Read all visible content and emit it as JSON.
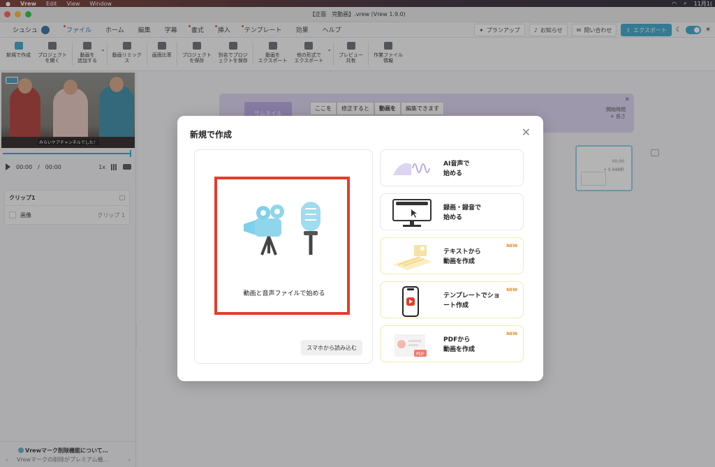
{
  "menubar": {
    "apple": "",
    "app": "Vrew",
    "edit": "Edit",
    "view": "View",
    "window": "Window",
    "time": "11月1("
  },
  "window": {
    "title": "【正面　完動画】.vrew (Vrew 1.9.0)"
  },
  "tabs": {
    "user": "シュシュ",
    "items": [
      {
        "label": "ファイル",
        "dot": true
      },
      {
        "label": "ホーム",
        "dot": false
      },
      {
        "label": "編集",
        "dot": false
      },
      {
        "label": "字幕",
        "dot": false
      },
      {
        "label": "書式",
        "dot": true
      },
      {
        "label": "挿入",
        "dot": true
      },
      {
        "label": "テンプレート",
        "dot": true
      },
      {
        "label": "効果",
        "dot": false
      },
      {
        "label": "ヘルプ",
        "dot": false
      }
    ]
  },
  "topright": {
    "plan": "プランアップ",
    "notice": "お知らせ",
    "contact": "問い合わせ",
    "export": "エクスポート"
  },
  "toolbar": {
    "items": [
      "新規で作成",
      "プロジェクト\nを開く",
      "動画を\n追加する",
      "動画リミック\nス",
      "画面比率",
      "プロジェクト\nを保存",
      "別名でプロジ\nェクトを保存",
      "動画を\nエクスポート",
      "他の形式で\nエクスポート",
      "プレビュー\n共有",
      "作業ファイル\n情報"
    ]
  },
  "player": {
    "caption": "みらいケアチャンネルでした！",
    "time_current": "00:00",
    "time_sep": "/",
    "time_total": "00:00",
    "speed": "1x"
  },
  "clips": {
    "title": "クリップ1",
    "row_label": "画像",
    "row_right": "クリップ 1"
  },
  "notice": {
    "title": "Vrewマーク削除機能について…",
    "desc": "Vrewマークの削除がプレミアム機…",
    "prev": "‹",
    "next": "›"
  },
  "banner": {
    "thumb": "サムネイル",
    "words": [
      "ここを",
      "修正すると",
      "動画を",
      "編集できます"
    ],
    "right1": "開始時間",
    "right2": "+ 長さ"
  },
  "clipcard": {
    "t1": "00:00",
    "t2": "+ 0.948秒"
  },
  "modal": {
    "title": "新規で作成",
    "main_label": "動画と音声ファイルで始める",
    "phone_button": "スマホから読み込む",
    "options": [
      {
        "label": "AI音声で\n始める",
        "new": ""
      },
      {
        "label": "録画・録音で\n始める",
        "new": ""
      },
      {
        "label": "テキストから\n動画を作成",
        "new": "NEW"
      },
      {
        "label": "テンプレートでショ\nート作成",
        "new": "NEW"
      },
      {
        "label": "PDFから\n動画を作成",
        "new": "NEW"
      }
    ]
  },
  "colors": {
    "accent": "#3aa6c9",
    "highlight": "#e43d2b",
    "tab_active": "#2b6aa6",
    "banner": "#dcd4f0"
  }
}
